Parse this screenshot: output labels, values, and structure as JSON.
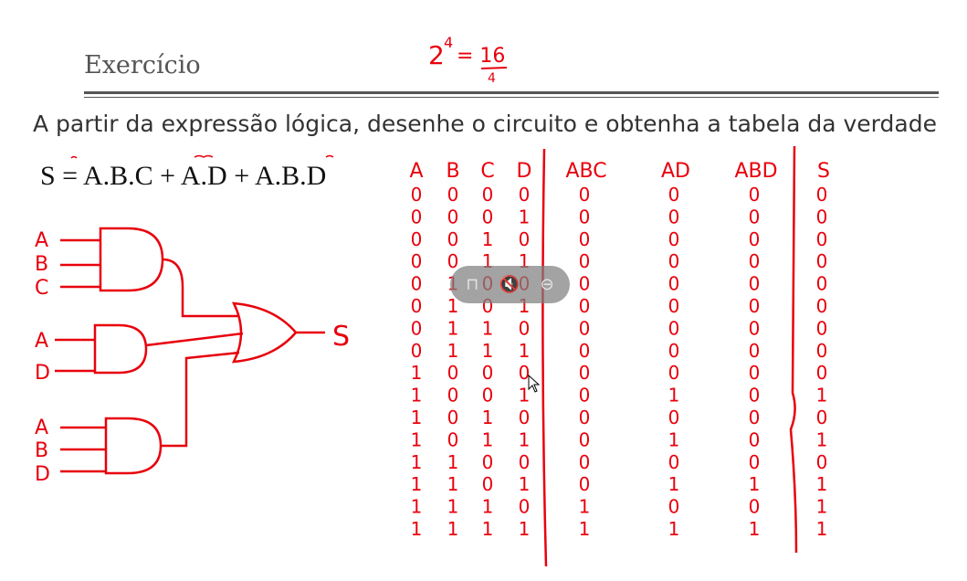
{
  "slide": {
    "title": "Exercício",
    "instruction": "A partir da expressão lógica, desenhe o circuito e obtenha a tabela da verdade",
    "expression": "S = A.B.C + A.D + A.B.D"
  },
  "annotation": {
    "base": "2",
    "exponent": "4",
    "result": "= 16"
  },
  "circuit": {
    "gate1_inputs": [
      "A",
      "B",
      "C"
    ],
    "gate2_inputs": [
      "A",
      "D"
    ],
    "gate3_inputs": [
      "A",
      "B",
      "D"
    ],
    "output": "S"
  },
  "truth_table": {
    "headers": [
      "A",
      "B",
      "C",
      "D",
      "ABC",
      "AD",
      "ABD",
      "S"
    ],
    "rows": [
      [
        "0",
        "0",
        "0",
        "0",
        "0",
        "0",
        "0",
        "0"
      ],
      [
        "0",
        "0",
        "0",
        "1",
        "0",
        "0",
        "0",
        "0"
      ],
      [
        "0",
        "0",
        "1",
        "0",
        "0",
        "0",
        "0",
        "0"
      ],
      [
        "0",
        "0",
        "1",
        "1",
        "0",
        "0",
        "0",
        "0"
      ],
      [
        "0",
        "1",
        "0",
        "0",
        "0",
        "0",
        "0",
        "0"
      ],
      [
        "0",
        "1",
        "0",
        "1",
        "0",
        "0",
        "0",
        "0"
      ],
      [
        "0",
        "1",
        "1",
        "0",
        "0",
        "0",
        "0",
        "0"
      ],
      [
        "0",
        "1",
        "1",
        "1",
        "0",
        "0",
        "0",
        "0"
      ],
      [
        "1",
        "0",
        "0",
        "0",
        "0",
        "0",
        "0",
        "0"
      ],
      [
        "1",
        "0",
        "0",
        "1",
        "0",
        "1",
        "0",
        "1"
      ],
      [
        "1",
        "0",
        "1",
        "0",
        "0",
        "0",
        "0",
        "0"
      ],
      [
        "1",
        "0",
        "1",
        "1",
        "0",
        "1",
        "0",
        "1"
      ],
      [
        "1",
        "1",
        "0",
        "0",
        "0",
        "0",
        "0",
        "0"
      ],
      [
        "1",
        "1",
        "0",
        "1",
        "0",
        "1",
        "1",
        "1"
      ],
      [
        "1",
        "1",
        "1",
        "0",
        "1",
        "0",
        "0",
        "1"
      ],
      [
        "1",
        "1",
        "1",
        "1",
        "1",
        "1",
        "1",
        "1"
      ]
    ]
  },
  "ink_color": "#e8000c",
  "player_overlay": {
    "icons": [
      "pin-icon",
      "mute-icon",
      "minus-circle-icon"
    ],
    "glyphs": [
      "⊓",
      "🔇",
      "⊖"
    ]
  }
}
